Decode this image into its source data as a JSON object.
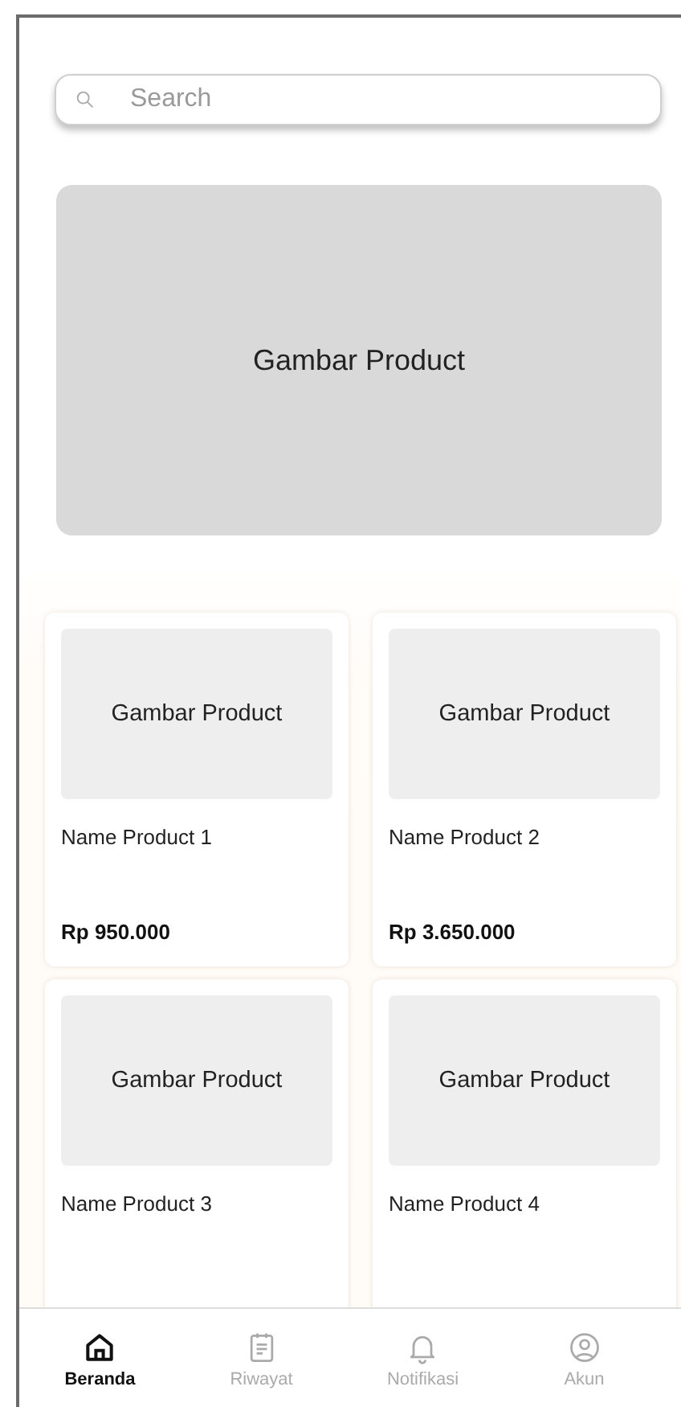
{
  "search": {
    "placeholder": "Search"
  },
  "banner": {
    "label": "Gambar Product"
  },
  "products": [
    {
      "image_label": "Gambar Product",
      "name": "Name Product 1",
      "price": "Rp 950.000"
    },
    {
      "image_label": "Gambar Product",
      "name": "Name Product 2",
      "price": "Rp 3.650.000"
    },
    {
      "image_label": "Gambar Product",
      "name": "Name Product 3"
    },
    {
      "image_label": "Gambar Product",
      "name": "Name Product 4"
    }
  ],
  "nav": [
    {
      "kind": "home",
      "label": "Beranda",
      "selected": true
    },
    {
      "kind": "history",
      "label": "Riwayat",
      "selected": false
    },
    {
      "kind": "notifications",
      "label": "Notifikasi",
      "selected": false
    },
    {
      "kind": "account",
      "label": "Akun",
      "selected": false
    }
  ]
}
